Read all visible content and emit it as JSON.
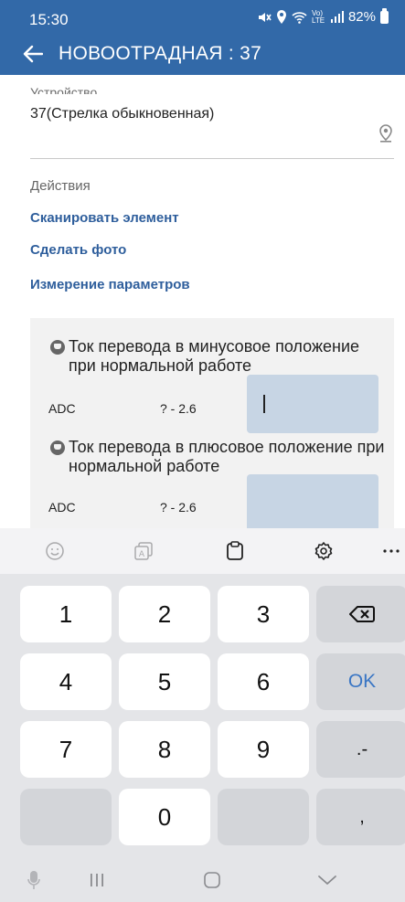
{
  "status_bar": {
    "time": "15:30",
    "network": "Vo) LTE",
    "battery": "82%"
  },
  "app_bar": {
    "title": "НОВООТРАДНАЯ : 37"
  },
  "device": {
    "label": "Устройство",
    "value": "37(Стрелка обыкновенная)"
  },
  "actions": {
    "label": "Действия",
    "items": [
      {
        "label": "Сканировать элемент"
      },
      {
        "label": "Сделать фото"
      },
      {
        "label": "Измерение параметров"
      }
    ]
  },
  "parameters": [
    {
      "title": "Ток перевода в минусовое положение при нормальной работе",
      "unit": "ADC",
      "range": "? - 2.6",
      "value": ""
    },
    {
      "title": "Ток перевода в плюсовое положение при нормальной работе",
      "unit": "ADC",
      "range": "? - 2.6",
      "value": ""
    }
  ],
  "keyboard": {
    "toolbar_icons": [
      "emoji-icon",
      "sticker-icon",
      "clipboard-icon",
      "settings-icon",
      "more-icon"
    ],
    "keys": {
      "k1": "1",
      "k2": "2",
      "k3": "3",
      "k4": "4",
      "k5": "5",
      "k6": "6",
      "k7": "7",
      "k8": "8",
      "k9": "9",
      "k0": "0",
      "ok": "OK",
      "dot_minus": ".-",
      "comma": ","
    },
    "nav_icons": [
      "mic-icon",
      "recent-apps-icon",
      "home-icon",
      "hide-keyboard-icon"
    ]
  },
  "colors": {
    "app_bar": "#3269a8",
    "link": "#2e5e9c",
    "input_fill": "#c7d5e4",
    "ok_key": "#3a76c4"
  }
}
